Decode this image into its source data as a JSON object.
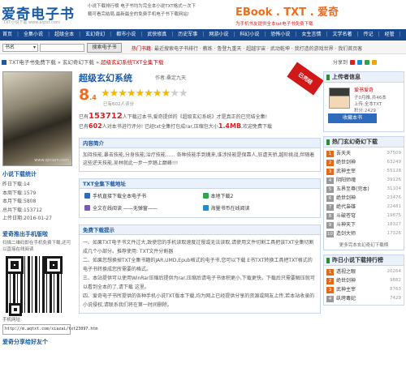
{
  "header": {
    "logo_main": "爱奇电子书",
    "logo_sub": "TXT小说下载 www.aqtxt.com",
    "tip_line1": "小说下载排行榜 电子书均为完全本小说TXT格式一次下",
    "tip_line2": "载可看完结局,最新最全的免费手机电子书下载网站!",
    "ebook_title": "EBook . TXT . 爱奇",
    "ebook_sub": "为手机书友提供全本txt电子书免费下载"
  },
  "nav": [
    "首页",
    "全集小说",
    "超级全本",
    "玄幻奇幻",
    "都市小说",
    "武侠修真",
    "历史军事",
    "网游小说",
    "科幻小说",
    "恐怖小说",
    "女生言情",
    "文学名著",
    "传记",
    "经管",
    "法律教育",
    "外国名著"
  ],
  "search": {
    "select_value": "书名",
    "button": "搜索电子书",
    "hot_label": "热门书籍:",
    "hot_items": "最近搜索电子书排行 · 教练 · 鲁登九重天 · 超越宇宙 · 武动乾坤 · 我打造的游戏世界 · 我们首页客"
  },
  "breadcrumb": {
    "home": "TXT电子书免费下载",
    "arrow": "»",
    "cat": "玄幻奇幻下载",
    "current": "超级玄幻系统TXT全集下载"
  },
  "share": {
    "label": "分享到"
  },
  "left": {
    "cover_watermark": "www.qiniam.com",
    "stats_title": "小说下载统计",
    "stats": [
      "昨日下载:14",
      "本周下载:1579",
      "本月下载:5808",
      "总共下载:153712",
      "上传日期:2016-01-27"
    ],
    "qr_title": "爱奇推出手机版啦",
    "qr_tip": "扫描二维码即在手机免费下载,还可以直接在线阅读",
    "mobile_label": "手机网址:",
    "mobile_url": "http://m.aqtxt.com/xiazai/txt23097.htm",
    "bottom_title": "爱奇分享给好友个"
  },
  "main": {
    "title": "超级玄幻系统",
    "author": "作者:桑定九天",
    "ribbon": "已完结",
    "score_int": "8",
    "score_dec": ".4",
    "votes": "已有602人评分",
    "info_l1_a": "已有",
    "info_l1_n": "153712",
    "info_l1_b": "人下载过本书,爱奇提供的《超级玄幻系统》才是真正的已完结全集!",
    "info_l2_a": "已有",
    "info_l2_n": "602",
    "info_l2_b": "人对本书进行评分! 已经txt全集打包成rar,压缩包大小",
    "info_l2_size": "1.4MB",
    "info_l2_c": ",欢迎免费下载",
    "intro_title": "内容简介",
    "intro_text": "加持技能,暴击技能,分身技能,治疗技能…… 各种技能手到擒来,谁涉技能是保靠人,狂虐天骄,越阶挑战,伴随着这些逆天技能,吴林就此一步一步踏上巅峰!!!",
    "dl_title": "TXT全集下载地址",
    "dl_items": [
      "手机直接下载全本电子书",
      "本地下载2",
      "全文在线阅读 ——无弹窗——",
      "海量书币在线阅读"
    ],
    "tips_title": "免费下载提示",
    "tips": [
      "一、如果TXT电子书文件过大,致使您的手机读取速度过慢或无法读取,请使用文件切割工具把该TXT全集切割成几个小部分。推荐使用: TXT文件分割器",
      "二、如果您想换掉TXT全集书籍的JAR,UMD,Epub格式的电子书,您可以下载 E书TXT转换工具把TXT格式的电子书转换成您所需要的格式。",
      "三、本站提供可以使用WinRar压缩后提供为rar,压缩后请电子书体积更小,下载更快。下载后只需要解压就可以看到全本的了,请下载 这里。",
      "四、爱奇电子书所提供的各种手机小说TXT版本下载,均为网上已经提供分享的资源或网友上传,若本站收录的小说侵权,请联系我们将在第一时间删除。"
    ]
  },
  "right": {
    "uploader_title": "上传者信息",
    "uploader_name": "爱书爱奇",
    "uploader_lines": [
      "子0月推,共46本",
      "上传:全本TXT",
      "积分:2429"
    ],
    "collect_btn": "收藏本书",
    "hot_title": "热门玄幻奇幻下载",
    "hot_list": [
      [
        "吾天天",
        "97509"
      ],
      [
        "绝世剑神",
        "63249"
      ],
      [
        "武神主宰",
        "55128"
      ],
      [
        "阴阳师魂",
        "39126"
      ],
      [
        "五界至尊(完本)",
        "31104"
      ],
      [
        "绝世剑神",
        "23476"
      ],
      [
        "绝代枭雄",
        "22481"
      ],
      [
        "斗破苍穹",
        "19875"
      ],
      [
        "斗神天下",
        "18327"
      ],
      [
        "造剑大师",
        "17326"
      ]
    ],
    "more": "更多完本玄幻奇幻下载榜",
    "y_title": "昨日小说下载排行榜",
    "y_list": [
      [
        "透视之眼",
        "20264"
      ],
      [
        "绝世剑神",
        "9882"
      ],
      [
        "武神主宰",
        "8763"
      ],
      [
        "纨绔毒妃",
        "7429"
      ]
    ]
  }
}
